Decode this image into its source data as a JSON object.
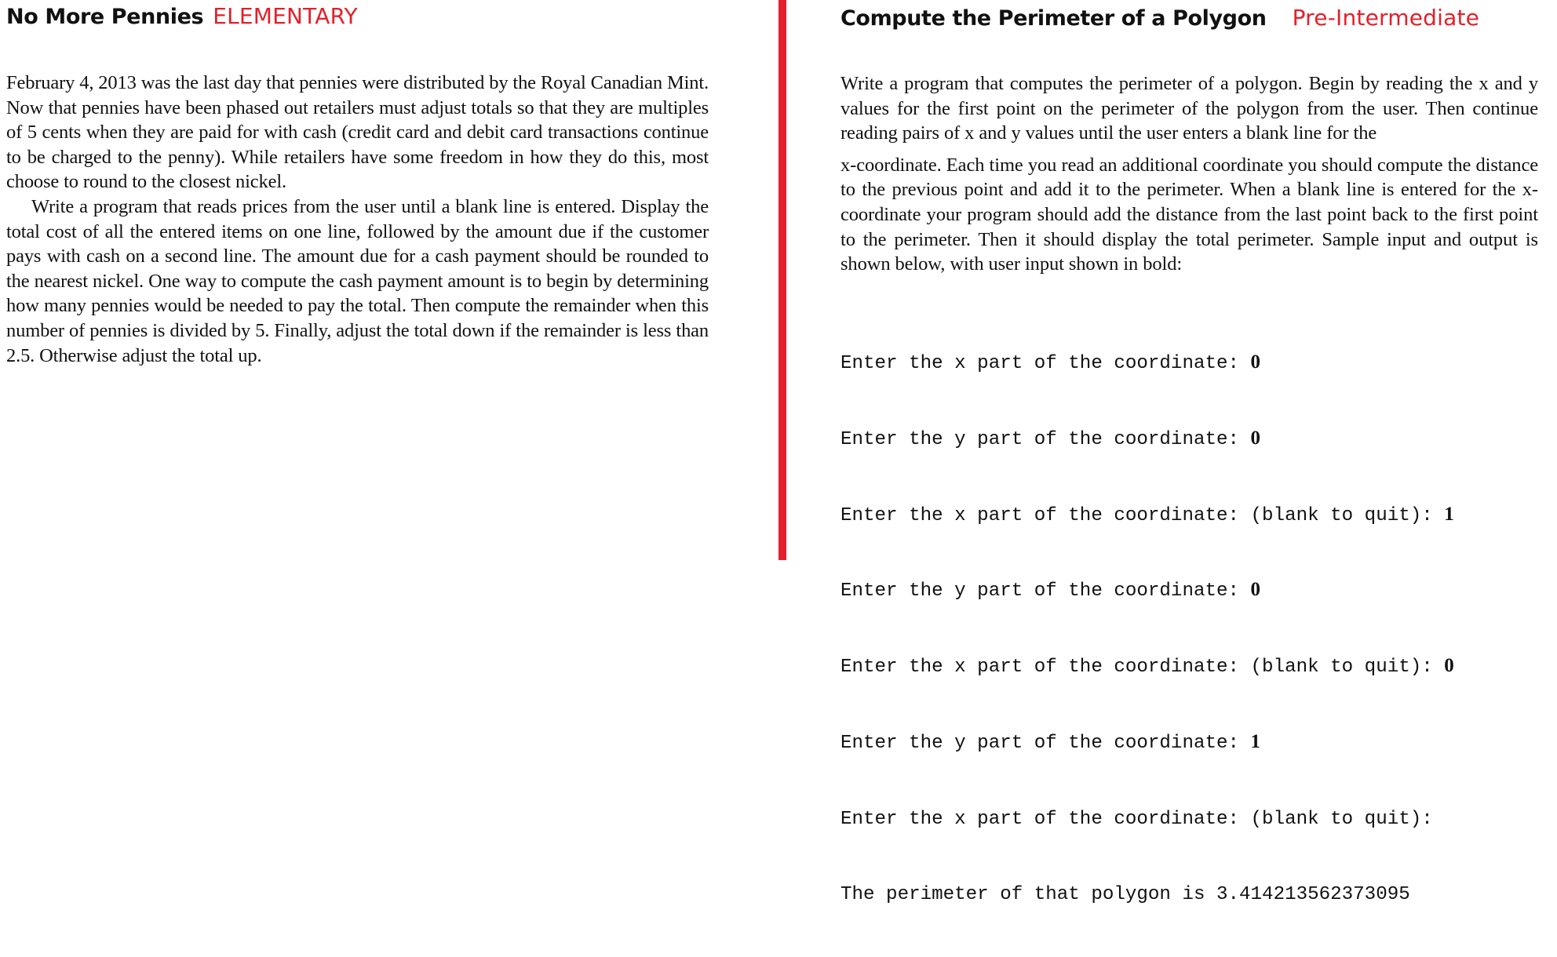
{
  "left": {
    "title": "No More Pennies",
    "level": "ELEMENTARY",
    "paragraphs": [
      "February 4, 2013 was the last day that pennies were distributed by the Royal Canadian Mint. Now that pennies have been phased out retailers must adjust totals so that they are multiples of 5 cents when they are paid for with cash (credit card and debit card transactions continue to be charged to the penny). While retailers have some freedom in how they do this, most choose to round to the closest nickel.",
      "Write a program that reads prices from the user until a blank line is entered. Display the total cost of all the entered items on one line, followed by the amount due if the customer pays with cash on a second line. The amount due for a cash payment should be rounded to the nearest nickel. One way to compute the cash payment amount is to begin by determining how many pennies would be needed to pay the total. Then compute the remainder when this number of pennies is divided by 5. Finally, adjust the total down if the remainder is less than 2.5. Otherwise adjust the total up."
    ]
  },
  "right": {
    "title": "Compute the Perimeter of a Polygon",
    "level": "Pre-Intermediate",
    "paragraph_part1": "Write a program that computes the perimeter of a polygon. Begin by reading the x and y values for the first point on the perimeter of the polygon from the user. Then continue reading pairs of x and y values until the user enters a blank line for the",
    "paragraph_part2": "x-coordinate. Each time you read an additional coordinate you should compute the distance to the previous point and add it to the perimeter. When a blank line is entered for the x-coordinate your program should add the distance from the last point back to the first point to the perimeter. Then it should display the total perimeter. Sample input and output is shown below, with user input shown in bold:",
    "sample": [
      {
        "prompt": "Enter the x part of the coordinate: ",
        "input": "0"
      },
      {
        "prompt": "Enter the y part of the coordinate: ",
        "input": "0"
      },
      {
        "prompt": "Enter the x part of the coordinate: (blank to quit): ",
        "input": "1"
      },
      {
        "prompt": "Enter the y part of the coordinate: ",
        "input": "0"
      },
      {
        "prompt": "Enter the x part of the coordinate: (blank to quit): ",
        "input": "0"
      },
      {
        "prompt": "Enter the y part of the coordinate: ",
        "input": "1"
      },
      {
        "prompt": "Enter the x part of the coordinate: (blank to quit):",
        "input": ""
      },
      {
        "prompt": "The perimeter of that polygon is 3.414213562373095",
        "input": ""
      }
    ]
  },
  "colors": {
    "accent": "#e3202b",
    "text": "#111111",
    "background": "#ffffff"
  }
}
